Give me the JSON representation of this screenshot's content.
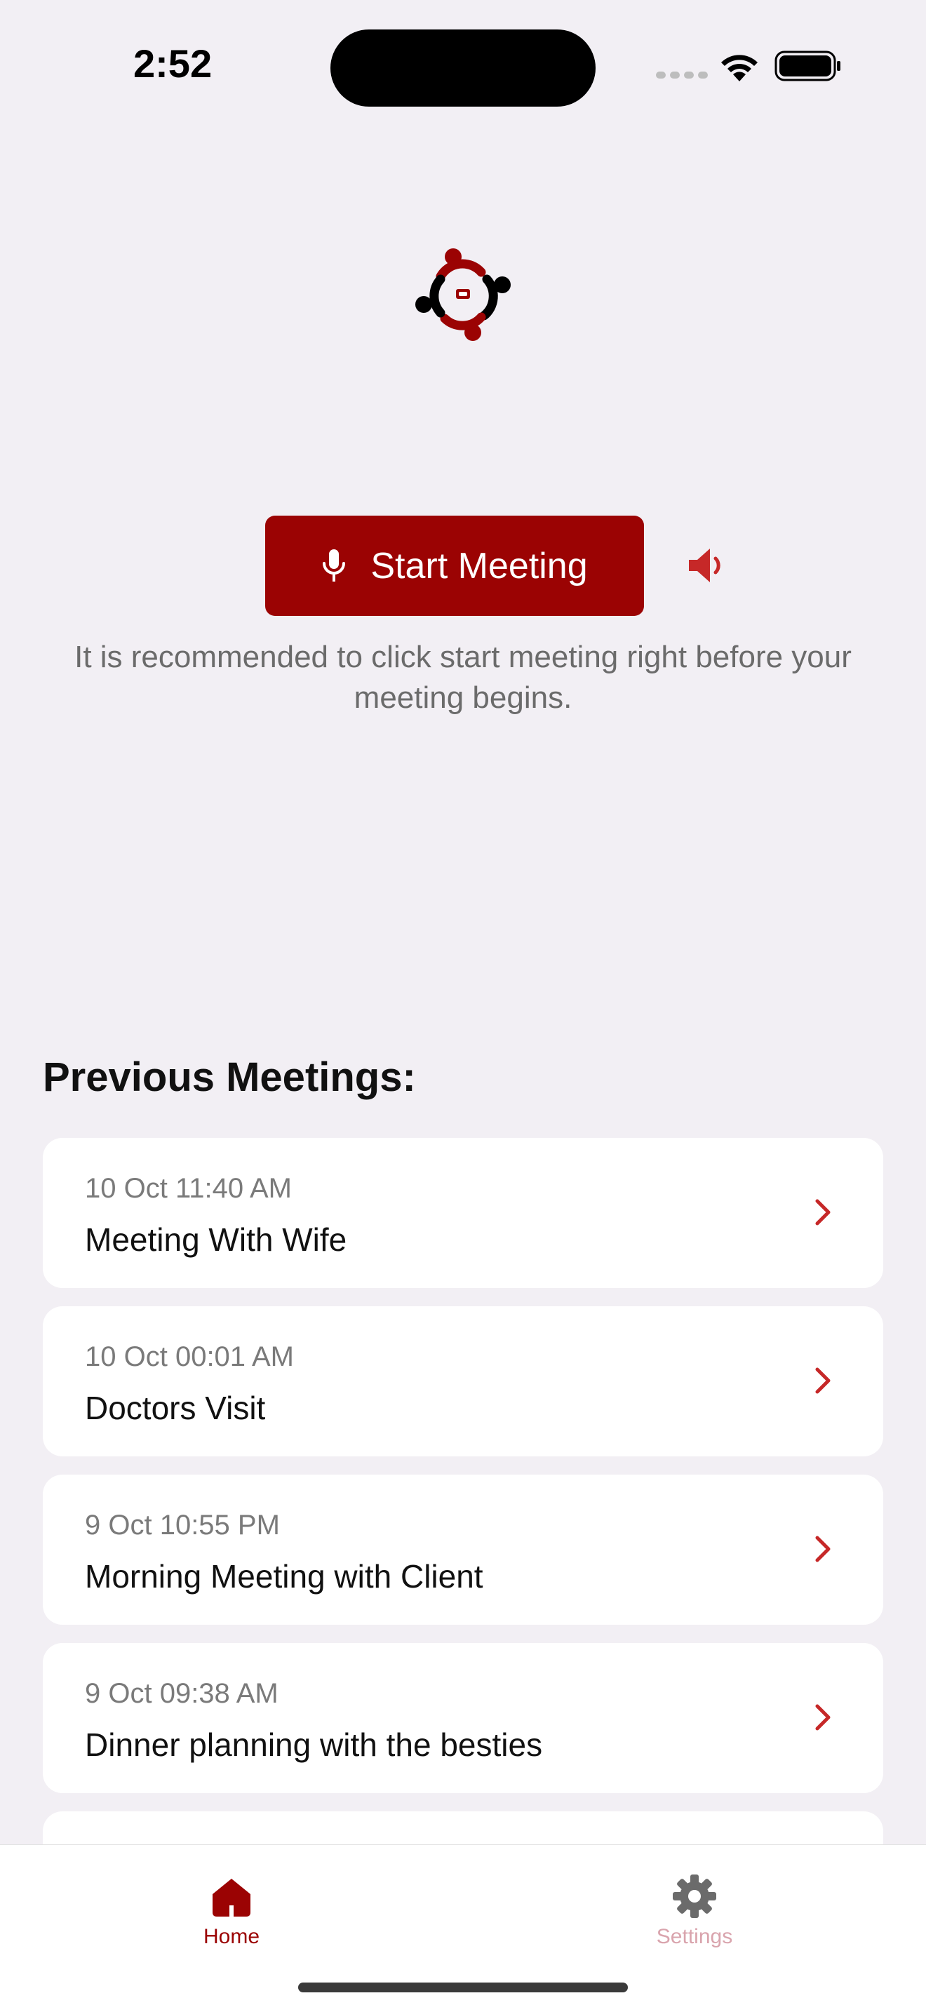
{
  "status_bar": {
    "time": "2:52"
  },
  "main": {
    "start_button_label": "Start Meeting",
    "hint_text": "It is recommended to click start meeting right before your meeting begins."
  },
  "previous": {
    "title": "Previous Meetings:",
    "items": [
      {
        "date": "10 Oct 11:40 AM",
        "title": "Meeting With Wife"
      },
      {
        "date": "10 Oct 00:01 AM",
        "title": "Doctors Visit"
      },
      {
        "date": "9 Oct 10:55 PM",
        "title": "Morning Meeting with Client"
      },
      {
        "date": "9 Oct 09:38 AM",
        "title": "Dinner planning with the besties"
      }
    ]
  },
  "tabs": [
    {
      "label": "Home",
      "icon": "home-icon",
      "active": true
    },
    {
      "label": "Settings",
      "icon": "gear-icon",
      "active": false
    }
  ],
  "colors": {
    "brand": "#9b0303",
    "background": "#f2eff4",
    "chevron": "#c62828",
    "inactive_tab": "#d9a4ad"
  }
}
